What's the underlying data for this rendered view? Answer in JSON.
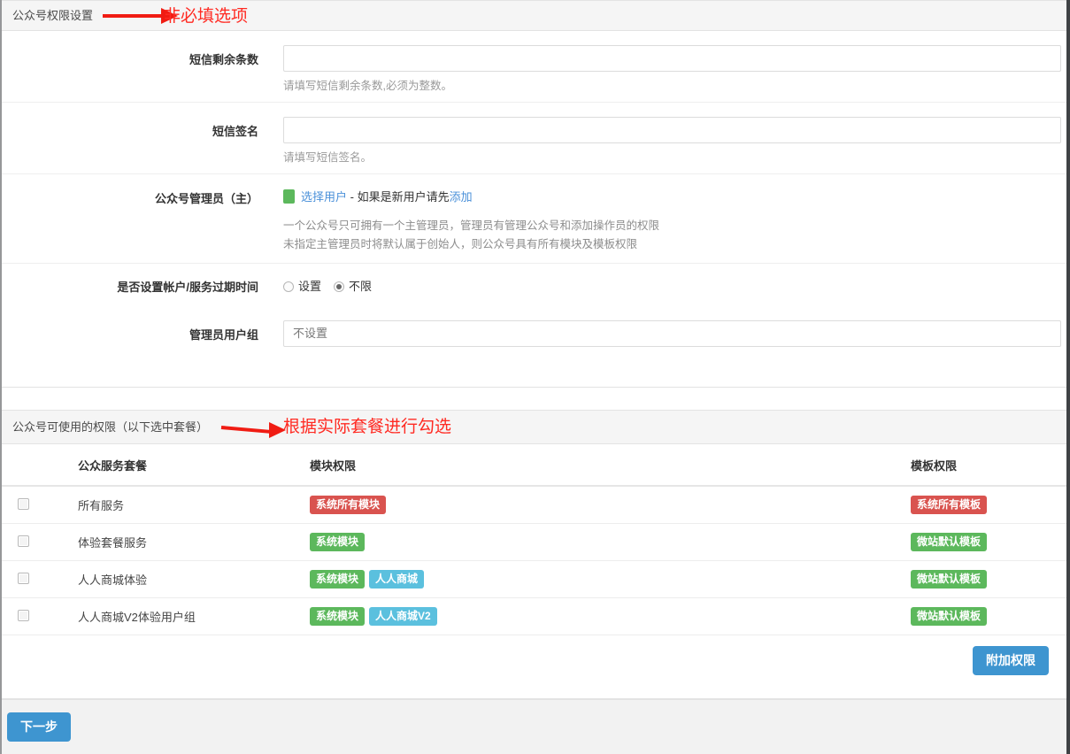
{
  "section1": {
    "header_title": "公众号权限设置",
    "annotation": "非必填选项",
    "fields": {
      "sms_remaining": {
        "label": "短信剩余条数",
        "value": "",
        "placeholder": "",
        "help": "请填写短信剩余条数,必须为整数。"
      },
      "sms_signature": {
        "label": "短信签名",
        "value": "",
        "placeholder": "",
        "help": "请填写短信签名。"
      },
      "admin": {
        "label": "公众号管理员（主）",
        "select_user_link": "选择用户",
        "dash": " - ",
        "hint_prefix": "如果是新用户请先",
        "add_link": "添加",
        "help_line1": "一个公众号只可拥有一个主管理员，管理员有管理公众号和添加操作员的权限",
        "help_line2": "未指定主管理员时将默认属于创始人，则公众号具有所有模块及模板权限"
      },
      "expire": {
        "label": "是否设置帐户/服务过期时间",
        "options": [
          {
            "label": "设置",
            "selected": false
          },
          {
            "label": "不限",
            "selected": true
          }
        ]
      },
      "admin_group": {
        "label": "管理员用户组",
        "value": "不设置"
      }
    }
  },
  "section2": {
    "header_title": "公众号可使用的权限（以下选中套餐）",
    "annotation": "根据实际套餐进行勾选",
    "table": {
      "columns": [
        "",
        "公众服务套餐",
        "模块权限",
        "模板权限"
      ],
      "rows": [
        {
          "checked": false,
          "name": "所有服务",
          "modules": [
            {
              "text": "系统所有模块",
              "color": "red"
            }
          ],
          "templates": [
            {
              "text": "系统所有模板",
              "color": "red"
            }
          ]
        },
        {
          "checked": false,
          "name": "体验套餐服务",
          "modules": [
            {
              "text": "系统模块",
              "color": "green"
            }
          ],
          "templates": [
            {
              "text": "微站默认模板",
              "color": "green"
            }
          ]
        },
        {
          "checked": false,
          "name": "人人商城体验",
          "modules": [
            {
              "text": "系统模块",
              "color": "green"
            },
            {
              "text": "人人商城",
              "color": "blue"
            }
          ],
          "templates": [
            {
              "text": "微站默认模板",
              "color": "green"
            }
          ]
        },
        {
          "checked": false,
          "name": "人人商城V2体验用户组",
          "modules": [
            {
              "text": "系统模块",
              "color": "green"
            },
            {
              "text": "人人商城V2",
              "color": "blue"
            }
          ],
          "templates": [
            {
              "text": "微站默认模板",
              "color": "green"
            }
          ]
        }
      ]
    },
    "extra_button": "附加权限"
  },
  "footer": {
    "next_button": "下一步"
  },
  "colors": {
    "annotation_red": "#ff2a22",
    "badge_red": "#d9534f",
    "badge_green": "#5cb85c",
    "badge_blue": "#5bc0de",
    "button_blue": "#3e95d0",
    "link_blue": "#4a90d9",
    "panel_head_bg": "#f5f5f5"
  }
}
